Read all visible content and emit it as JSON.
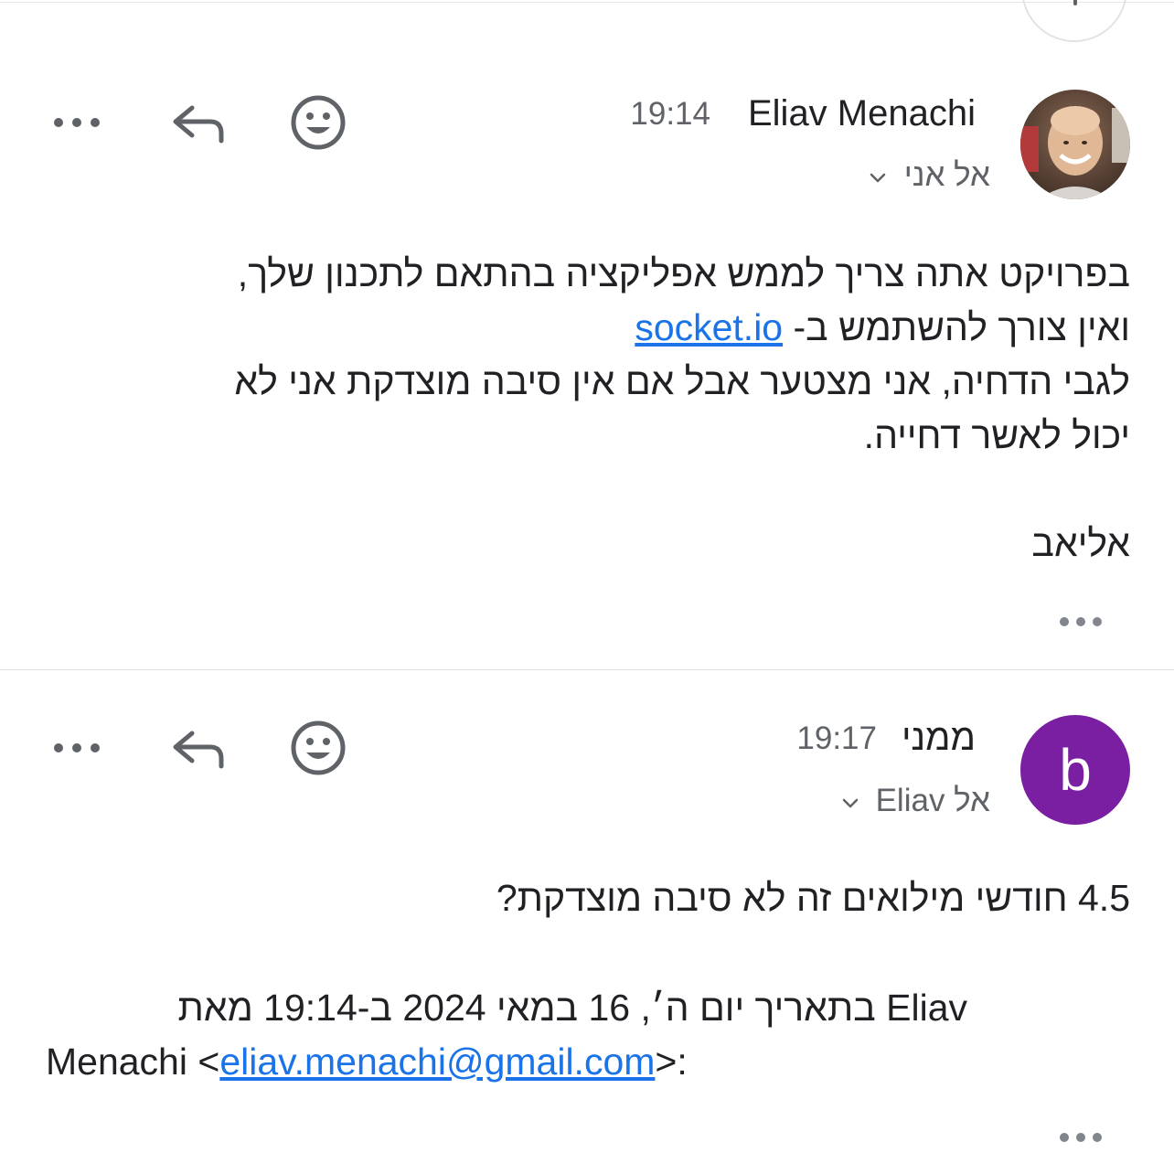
{
  "messages": [
    {
      "sender": "Eliav Menachi",
      "time": "19:14",
      "recipient": "אל אני",
      "avatar": "photo",
      "body": {
        "line1": "בפרויקט אתה צריך לממש אפליקציה בהתאם לתכנון שלך,",
        "line2_text": "ואין צורך להשתמש ב-",
        "line2_link": "socket.io",
        "line3": "לגבי הדחיה, אני מצטער אבל אם אין סיבה מוצדקת אני לא",
        "line4": "יכול לאשר דחייה.",
        "signature": "אליאב"
      }
    },
    {
      "sender": "ממני",
      "time": "19:17",
      "recipient": "אל Eliav",
      "avatar_letter": "b",
      "avatar_color": "#7b1fa2",
      "body": {
        "line1": "4.5 חודשי מילואים זה לא סיבה מוצדקת?",
        "quote_line1": "Eliav בתאריך יום ה׳, 16 במאי 2024 ב-19:14 מאת",
        "quote_line2_prefix": "Menachi <",
        "quote_email": "eliav.menachi@gmail.com",
        "quote_line2_suffix": ">:"
      }
    }
  ],
  "icons": {
    "more": "more-horizontal-icon",
    "reply": "reply-icon",
    "emoji": "smiley-icon",
    "chevron": "chevron-down-icon",
    "quoted_more": "show-quoted-text-icon"
  },
  "colors": {
    "link": "#1a73e8",
    "secondary_text": "#5f6368",
    "icon": "#5f6368",
    "avatar_b": "#7b1fa2"
  }
}
